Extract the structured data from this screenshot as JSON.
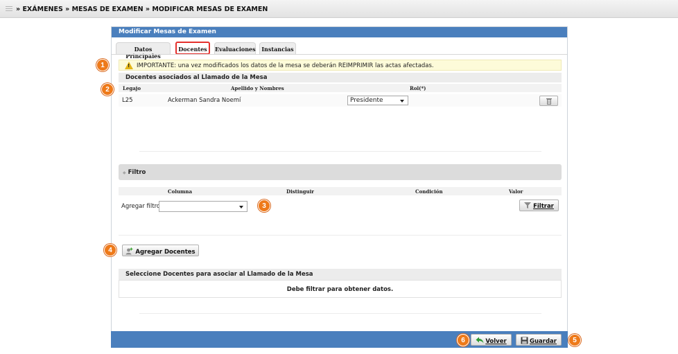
{
  "breadcrumb": "» EXÁMENES » MESAS DE EXAMEN » MODIFICAR MESAS DE EXAMEN",
  "panel": {
    "title": "Modificar Mesas de Examen"
  },
  "tabs": [
    {
      "label": "Datos Principales"
    },
    {
      "label": "Docentes"
    },
    {
      "label": "Evaluaciones"
    },
    {
      "label": "Instancias"
    }
  ],
  "warning": "IMPORTANTE: una vez modificados los datos de la mesa se deberán REIMPRIMIR las actas afectadas.",
  "docentes": {
    "title": "Docentes asociados al Llamado de la Mesa",
    "columns": [
      "Legajo",
      "Apellido y Nombres",
      "Rol(*)"
    ],
    "rows": [
      {
        "legajo": "L25",
        "nombre": "Ackerman Sandra Noemí",
        "rol": "Presidente"
      }
    ]
  },
  "filtro": {
    "title": "Filtro",
    "columns": [
      "Columna",
      "Distinguir",
      "Condición",
      "Valor"
    ],
    "add_label": "Agregar filtro",
    "add_value": "",
    "filter_button": "Filtrar"
  },
  "agregar_button": "Agregar Docentes",
  "seleccione": {
    "title": "Seleccione Docentes para asociar al Llamado de la Mesa",
    "empty": "Debe filtrar para obtener datos."
  },
  "footer": {
    "volver": "Volver",
    "guardar": "Guardar"
  },
  "badges": [
    "1",
    "2",
    "3",
    "4",
    "5",
    "6"
  ],
  "colors": {
    "header_blue": "#4a7fbd",
    "badge_orange": "#ee7a1a",
    "active_tab_border": "#e4302c"
  }
}
